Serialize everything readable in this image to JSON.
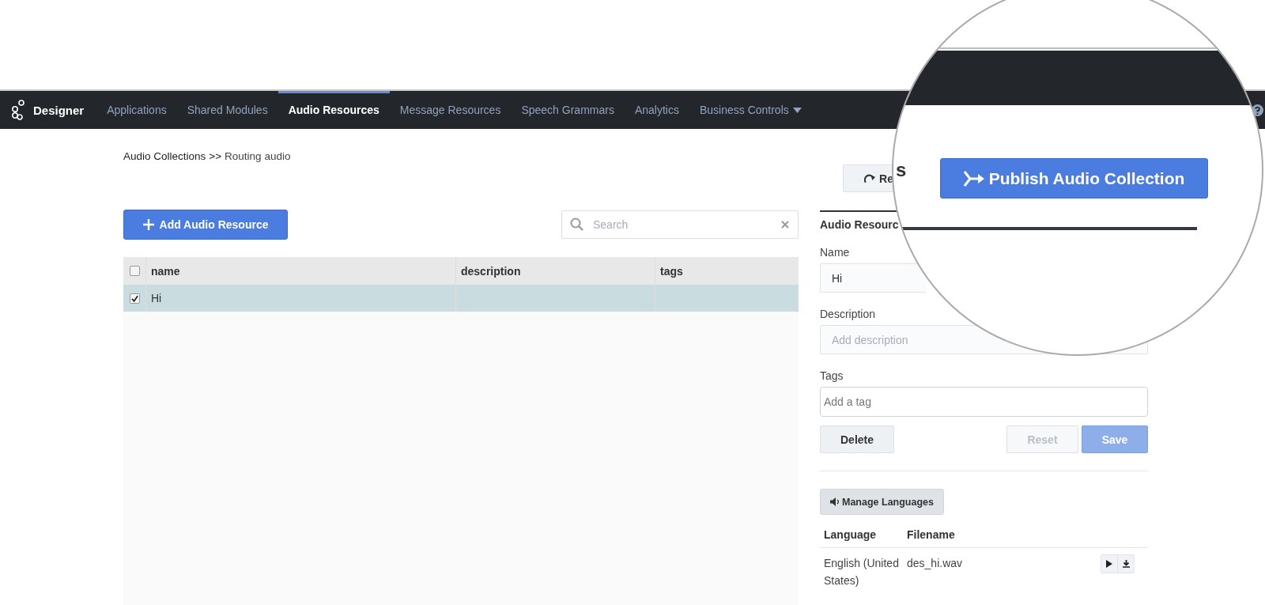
{
  "nav": {
    "brand": "Designer",
    "tabs": [
      {
        "label": "Applications",
        "selected": false,
        "has_menu": false
      },
      {
        "label": "Shared Modules",
        "selected": false,
        "has_menu": false
      },
      {
        "label": "Audio Resources",
        "selected": true,
        "has_menu": false
      },
      {
        "label": "Message Resources",
        "selected": false,
        "has_menu": false
      },
      {
        "label": "Speech Grammars",
        "selected": false,
        "has_menu": false
      },
      {
        "label": "Analytics",
        "selected": false,
        "has_menu": false
      },
      {
        "label": "Business Controls",
        "selected": false,
        "has_menu": true
      }
    ]
  },
  "breadcrumb": {
    "parent": "Audio Collections",
    "separator": ">>",
    "current": "Routing audio"
  },
  "add_button": "Add Audio Resource",
  "search": {
    "placeholder": "Search"
  },
  "table": {
    "header_checked": false,
    "columns": [
      "name",
      "description",
      "tags"
    ],
    "rows": [
      {
        "name": "Hi",
        "checked": true,
        "selected": true
      }
    ]
  },
  "editor": {
    "restore_button": "Re",
    "heading": "Audio Resourc",
    "fields": [
      {
        "label": "Name",
        "value": "Hi"
      },
      {
        "label": "Description",
        "placeholder": "Add description"
      },
      {
        "label": "Tags",
        "placeholder": "Add a tag"
      }
    ],
    "buttons": [
      {
        "label": "Delete",
        "kind": "default",
        "disabled": false
      },
      {
        "label": "Reset",
        "kind": "default",
        "disabled": true
      },
      {
        "label": "Save",
        "kind": "primary",
        "disabled": true
      }
    ],
    "manage_button": "Manage Languages",
    "language_columns": [
      "Language",
      "Filename"
    ],
    "languages": [
      {
        "language": "English (United States)",
        "filename": "des_hi.wav"
      }
    ]
  },
  "magnifier": {
    "fragment": "s",
    "publish_button": "Publish Audio Collection"
  }
}
